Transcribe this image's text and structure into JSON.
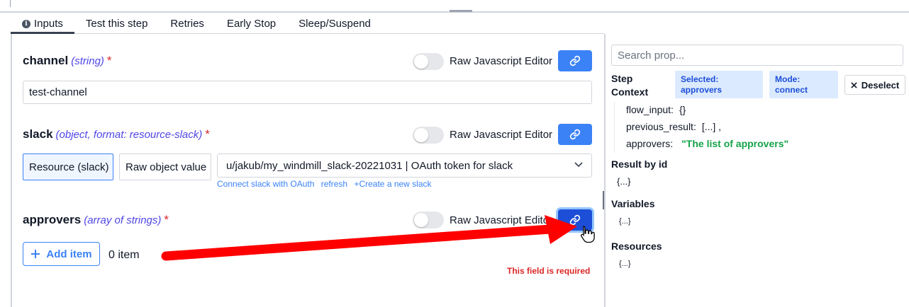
{
  "tabs": [
    {
      "label": "Inputs",
      "active": true
    },
    {
      "label": "Test this step"
    },
    {
      "label": "Retries"
    },
    {
      "label": "Early Stop"
    },
    {
      "label": "Sleep/Suspend"
    }
  ],
  "raw_js_label": "Raw Javascript Editor",
  "channel": {
    "name": "channel",
    "type": "(string)",
    "required_mark": "*",
    "value": "test-channel"
  },
  "slack": {
    "name": "slack",
    "type": "(object, format: resource-slack)",
    "required_mark": "*",
    "resource_button": "Resource (slack)",
    "raw_object_button": "Raw object value",
    "selected_resource": "u/jakub/my_windmill_slack-20221031 | OAuth token for slack",
    "links": [
      "Connect slack with OAuth",
      "refresh",
      "+Create a new slack"
    ]
  },
  "approvers": {
    "name": "approvers",
    "type": "(array of strings)",
    "required_mark": "*",
    "add_label": "Add item",
    "count": "0 item",
    "error": "This field is required"
  },
  "panel": {
    "search_placeholder": "Search prop...",
    "step_context": "Step Context",
    "badge_selected": "Selected: approvers",
    "badge_mode": "Mode: connect",
    "deselect": "Deselect",
    "context": [
      {
        "key": "flow_input:",
        "value": "{}"
      },
      {
        "key": "previous_result:",
        "value": "[...] ,"
      },
      {
        "key": "approvers:",
        "value": "\"The list of approvers\""
      }
    ],
    "result_by_id": "Result by id",
    "result_value": "{...}",
    "variables": "Variables",
    "variables_value": "{...}",
    "resources": "Resources",
    "resources_value": "{...}"
  },
  "colors": {
    "accent": "#3b82f6",
    "accent_dark": "#1d4ed8",
    "badge_bg": "#dbeafe",
    "error": "#dc2626",
    "string_green": "#16a34a",
    "arrow": "#ff0000"
  },
  "icons": [
    "info-icon",
    "link-icon",
    "plus-icon",
    "chevron-down-icon",
    "close-icon",
    "hand-pointer-icon"
  ]
}
